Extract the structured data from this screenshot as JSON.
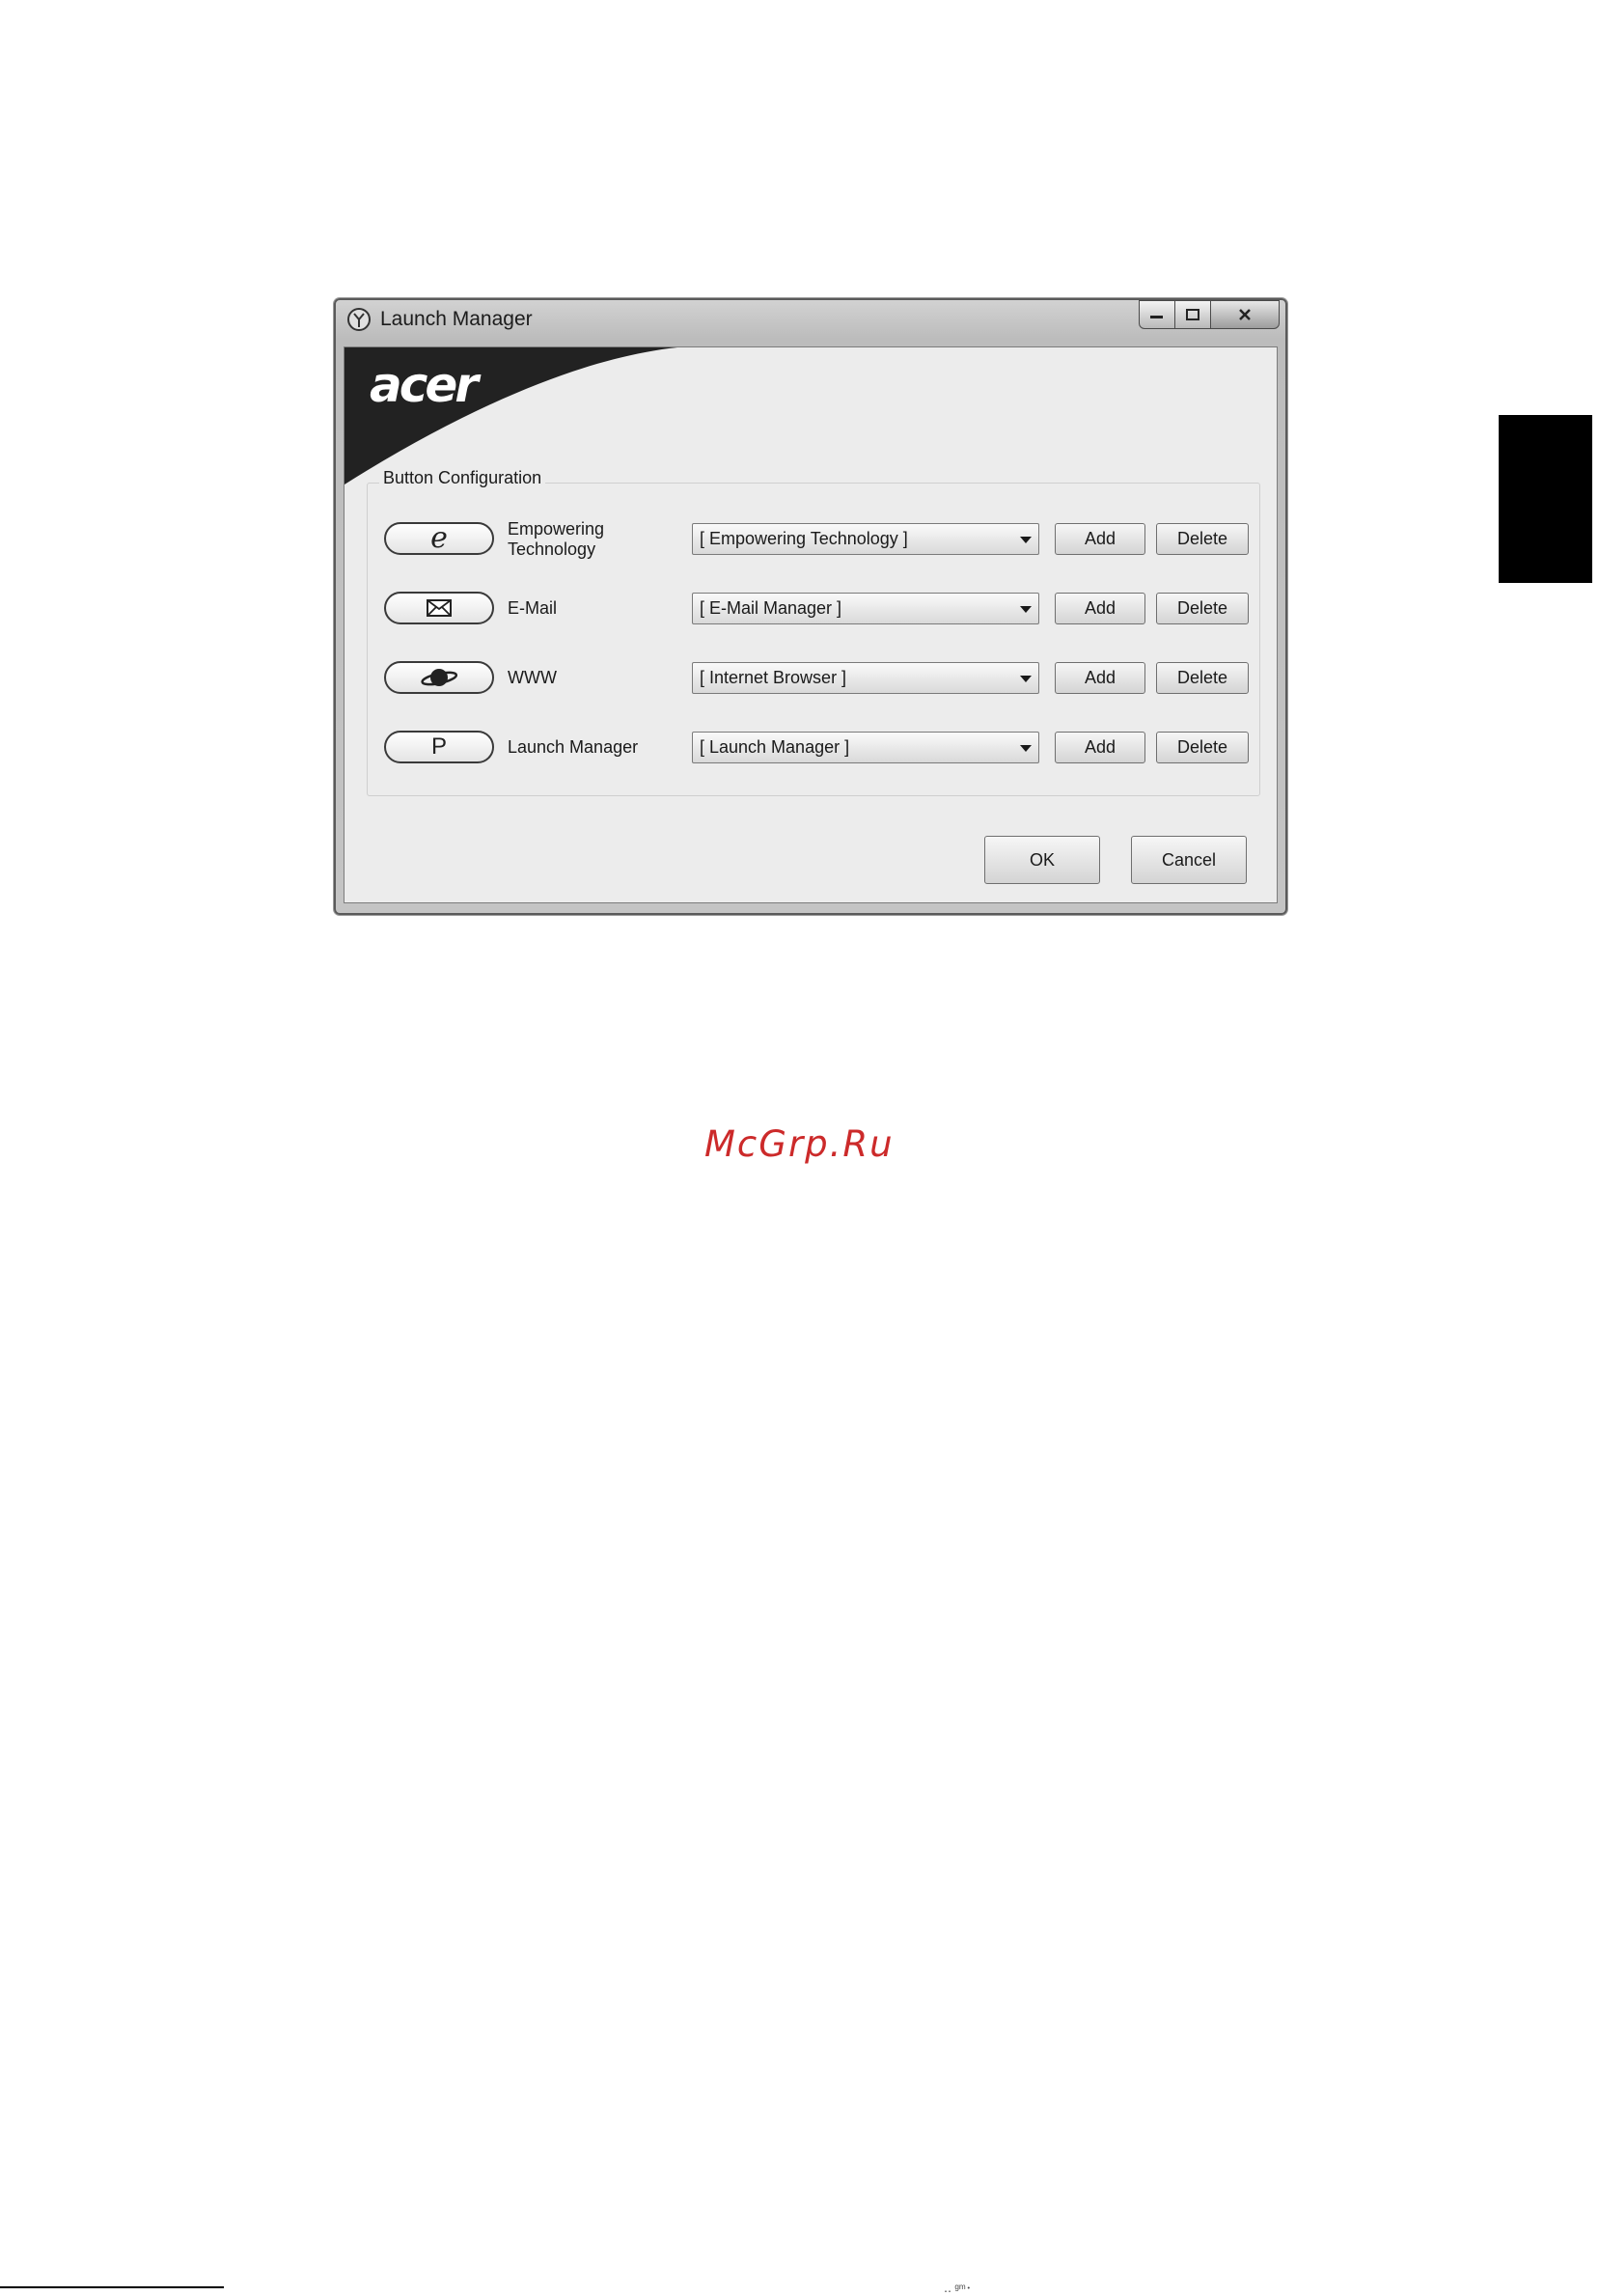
{
  "window": {
    "title": "Launch Manager",
    "logo": "acer",
    "group_label": "Button Configuration",
    "rows": [
      {
        "label": "Empowering Technology",
        "selected": "[  Empowering Technology  ]",
        "add": "Add",
        "delete": "Delete",
        "key": "e"
      },
      {
        "label": "E-Mail",
        "selected": "[  E-Mail Manager  ]",
        "add": "Add",
        "delete": "Delete",
        "key": "envelope"
      },
      {
        "label": "WWW",
        "selected": "[  Internet Browser  ]",
        "add": "Add",
        "delete": "Delete",
        "key": "planet"
      },
      {
        "label": "Launch Manager",
        "selected": "[  Launch Manager  ]",
        "add": "Add",
        "delete": "Delete",
        "key": "P"
      }
    ],
    "ok_label": "OK",
    "cancel_label": "Cancel"
  },
  "labels": {
    "empowering_line1": "Empowering",
    "empowering_line2": "Technology",
    "key_e": "e",
    "key_p": "P"
  },
  "watermark": "McGrp.Ru",
  "footer_mark": "․․ ᵍᵐ･"
}
